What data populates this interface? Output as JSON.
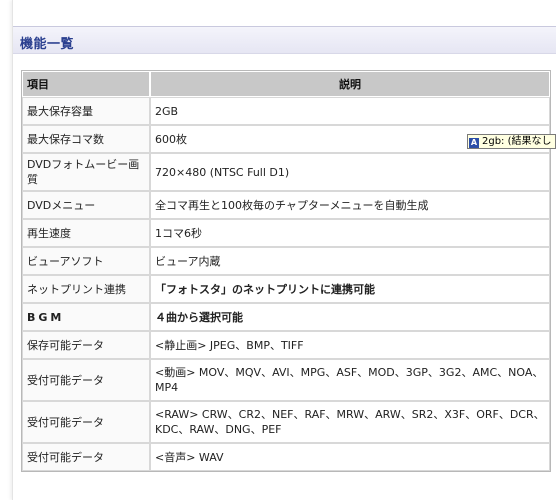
{
  "section": {
    "title": "機能一覧"
  },
  "table": {
    "headers": {
      "item": "項目",
      "description": "説明"
    },
    "rows": [
      {
        "item": "最大保存容量",
        "description": "2GB"
      },
      {
        "item": "最大保存コマ数",
        "description": "600枚"
      },
      {
        "item": "DVDフォトムービー画質",
        "description": "720×480 (NTSC Full D1)"
      },
      {
        "item": "DVDメニュー",
        "description": "全コマ再生と100枚毎のチャプターメニューを自動生成"
      },
      {
        "item": "再生速度",
        "description": "1コマ6秒"
      },
      {
        "item": "ビューアソフト",
        "description": "ビューア内蔵"
      },
      {
        "item": "ネットプリント連携",
        "description": "「フォトスタ」のネットプリントに連携可能"
      },
      {
        "item": "BGM",
        "description": "４曲から選択可能"
      },
      {
        "item": "保存可能データ",
        "description": "<静止画>  JPEG、BMP、TIFF"
      },
      {
        "item": "受付可能データ",
        "description": "<動画>  MOV、MQV、AVI、MPG、ASF、MOD、3GP、3G2、AMC、NOA、MP4"
      },
      {
        "item": "受付可能データ",
        "description": "<RAW>  CRW、CR2、NEF、RAF、MRW、ARW、SR2、X3F、ORF、DCR、KDC、RAW、DNG、PEF"
      },
      {
        "item": "受付可能データ",
        "description": "<音声>  WAV"
      }
    ]
  },
  "tooltip": {
    "icon": "A",
    "text": "2gb: (結果なし"
  }
}
